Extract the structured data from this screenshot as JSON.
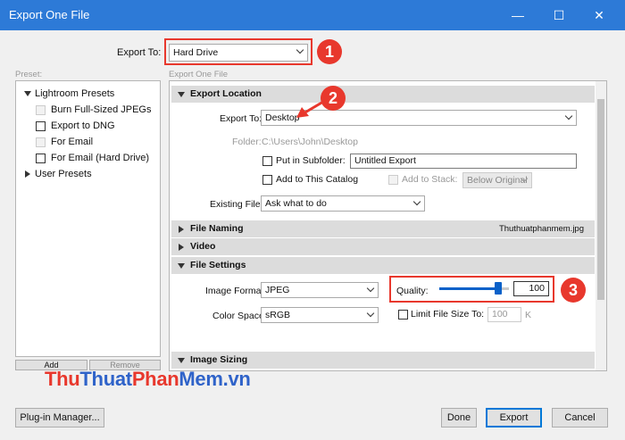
{
  "window": {
    "title": "Export One File",
    "minimize_icon": "minimize-icon",
    "maximize_icon": "maximize-icon",
    "close_icon": "close-icon"
  },
  "export_to_top": {
    "label": "Export To:",
    "value": "Hard Drive"
  },
  "preset": {
    "heading": "Preset:",
    "groups": [
      {
        "label": "Lightroom Presets",
        "expanded": true
      },
      {
        "label": "User Presets",
        "expanded": false
      }
    ],
    "items": [
      {
        "label": "Burn Full-Sized JPEGs",
        "enabled": false
      },
      {
        "label": "Export to DNG",
        "enabled": true
      },
      {
        "label": "For Email",
        "enabled": false
      },
      {
        "label": "For Email (Hard Drive)",
        "enabled": true
      }
    ],
    "add_label": "Add",
    "remove_label": "Remove"
  },
  "main": {
    "heading": "Export One File",
    "export_location": {
      "title": "Export Location",
      "export_to_label": "Export To:",
      "export_to_value": "Desktop",
      "folder_label": "Folder:",
      "folder_value": "C:\\Users\\John\\Desktop",
      "subfolder_label": "Put in Subfolder:",
      "subfolder_value": "Untitled Export",
      "add_catalog_label": "Add to This Catalog",
      "add_stack_label": "Add to Stack:",
      "stack_value": "Below Original",
      "existing_label": "Existing Files:",
      "existing_value": "Ask what to do"
    },
    "file_naming": {
      "title": "File Naming",
      "filename": "Thuthuatphanmem.jpg"
    },
    "video": {
      "title": "Video"
    },
    "file_settings": {
      "title": "File Settings",
      "format_label": "Image Format:",
      "format_value": "JPEG",
      "quality_label": "Quality:",
      "quality_value": "100",
      "quality_level": 100,
      "color_space_label": "Color Space:",
      "color_space_value": "sRGB",
      "limit_label": "Limit File Size To:",
      "limit_value": "100",
      "limit_unit": "K"
    },
    "image_sizing": {
      "title": "Image Sizing"
    }
  },
  "footer": {
    "plugin_manager": "Plug-in Manager...",
    "done": "Done",
    "export": "Export",
    "cancel": "Cancel"
  },
  "annotations": {
    "badge1": "1",
    "badge2": "2",
    "badge3": "3",
    "color": "#e8382d"
  },
  "watermark": {
    "part1": "Thu",
    "part2": "Thuat",
    "part3": "Phan",
    "part4": "Mem",
    "part5": ".vn"
  }
}
